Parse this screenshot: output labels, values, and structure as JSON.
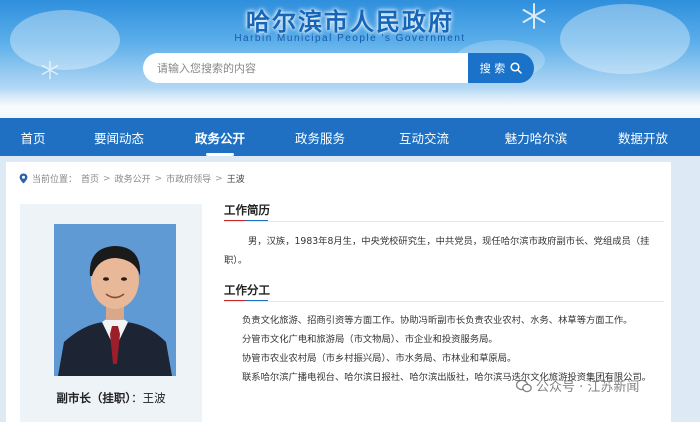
{
  "header": {
    "site_title": "哈尔滨市人民政府",
    "site_subtitle": "Harbin Municipal People ′s Government",
    "search_placeholder": "请输入您搜索的内容",
    "search_button": "搜 索"
  },
  "nav": {
    "items": [
      "首页",
      "要闻动态",
      "政务公开",
      "政务服务",
      "互动交流",
      "魅力哈尔滨",
      "数据开放"
    ],
    "active": "政务公开"
  },
  "breadcrumb": {
    "label": "当前位置：",
    "items": [
      "首页",
      "政务公开",
      "市政府领导",
      "王波"
    ]
  },
  "profile": {
    "title": "副市长（挂职）",
    "colon": "：",
    "name": "王波"
  },
  "resume": {
    "heading": "工作简历",
    "text": "男，汉族，1983年8月生，中央党校研究生，中共党员，现任哈尔滨市政府副市长、党组成员（挂职）。"
  },
  "duties": {
    "heading": "工作分工",
    "lines": [
      "负责文化旅游、招商引资等方面工作。协助冯昕副市长负责农业农村、水务、林草等方面工作。",
      "分管市文化广电和旅游局（市文物局）、市企业和投资服务局。",
      "协管市农业农村局（市乡村振兴局）、市水务局、市林业和草原局。",
      "联系哈尔滨广播电视台、哈尔滨日报社、哈尔滨出版社，哈尔滨马迭尔文化旅游投资集团有限公司。"
    ]
  },
  "watermark": {
    "text": "公众号 · 江苏新闻"
  },
  "colors": {
    "nav_bg": "#1f70c2",
    "title": "#1565b8",
    "accent_red": "#c82a2a"
  }
}
